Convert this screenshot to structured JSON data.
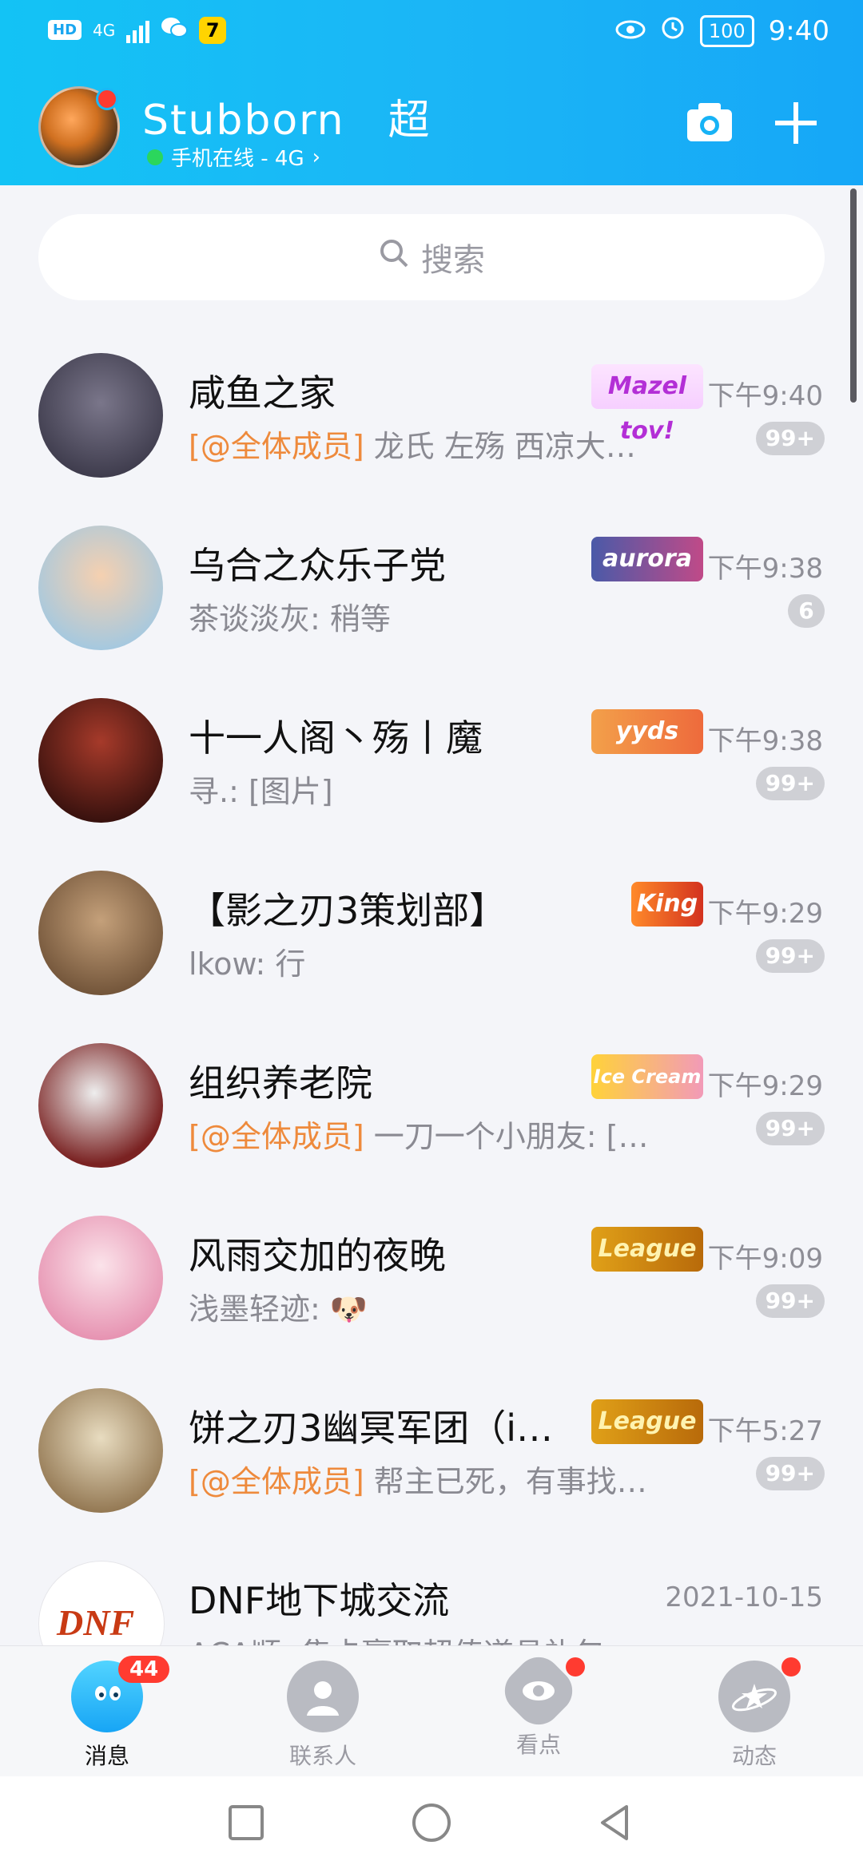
{
  "status_bar": {
    "left_chips": [
      "HD",
      "4G"
    ],
    "app_icon_text": "7",
    "battery": "100",
    "time": "9:40"
  },
  "header": {
    "user_name": "Stubborn　超",
    "status_text": "手机在线 - 4G",
    "camera_icon": "camera-icon",
    "add_icon": "plus-icon"
  },
  "search": {
    "placeholder": "搜索"
  },
  "chats": [
    {
      "title": "咸鱼之家",
      "mention": "[@全体成员]",
      "preview": " 龙氏 左殇 西凉大…",
      "tag": "Mazel tov!",
      "time": "下午9:40",
      "badge": "99+",
      "avatar_color": "#3c3a52",
      "tag_color": "#b32fd6"
    },
    {
      "title": "乌合之众乐子党",
      "mention": "",
      "preview": "茶谈淡灰: 稍等",
      "tag": "aurora",
      "time": "下午9:38",
      "badge": "6",
      "avatar_color": "#c7a37a",
      "tag_color": "#4a5aa8"
    },
    {
      "title": "十一人阁丶殇丨魔",
      "mention": "",
      "preview": "寻.: [图片]",
      "tag": "yyds",
      "time": "下午9:38",
      "badge": "99+",
      "avatar_color": "#4a1414",
      "tag_color": "#ee6a3c"
    },
    {
      "title": "【影之刃3策划部】",
      "mention": "",
      "preview": "lkow: 行",
      "tag": "King",
      "time": "下午9:29",
      "badge": "99+",
      "avatar_color": "#8a6a48",
      "tag_color": "#d3321f"
    },
    {
      "title": "组织养老院",
      "mention": "[@全体成员]",
      "preview": " 一刀一个小朋友: […",
      "tag": "Ice Cream",
      "time": "下午9:29",
      "badge": "99+",
      "avatar_color": "#6a2a2a",
      "tag_color": "#f5b21a"
    },
    {
      "title": "风雨交加的夜晚",
      "mention": "",
      "preview": "浅墨轻迹: 🐶",
      "tag": "League",
      "time": "下午9:09",
      "badge": "99+",
      "avatar_color": "#e6a0b6",
      "tag_color": "#d39a14"
    },
    {
      "title": "饼之刃3幽冥军团（i…",
      "mention": "[@全体成员]",
      "preview": " 帮主已死，有事找…",
      "tag": "League",
      "time": "下午5:27",
      "badge": "99+",
      "avatar_color": "#9c8052",
      "tag_color": "#d39a14"
    },
    {
      "title": "DNF地下城交流",
      "mention": "",
      "preview": "ACA顺: 集卡赢取超值道具礼包",
      "tag": "",
      "time": "2021-10-15",
      "badge": "",
      "avatar_color": "#ffffff",
      "tag_color": ""
    }
  ],
  "bottom_nav": [
    {
      "label": "消息",
      "icon": "chat-bubble-icon",
      "badge": "44",
      "dot": false,
      "active": true
    },
    {
      "label": "联系人",
      "icon": "contact-icon",
      "badge": "",
      "dot": false,
      "active": false
    },
    {
      "label": "看点",
      "icon": "eye-icon",
      "badge": "",
      "dot": true,
      "active": false
    },
    {
      "label": "动态",
      "icon": "planet-star-icon",
      "badge": "",
      "dot": true,
      "active": false
    }
  ],
  "colors": {
    "header_gradient_start": "#13c3f5",
    "header_gradient_end": "#16a7f7",
    "mention": "#ee8a3c",
    "badge_gray": "#cfd0d5",
    "badge_red": "#ff3b30",
    "online_green": "#2bd65c"
  }
}
